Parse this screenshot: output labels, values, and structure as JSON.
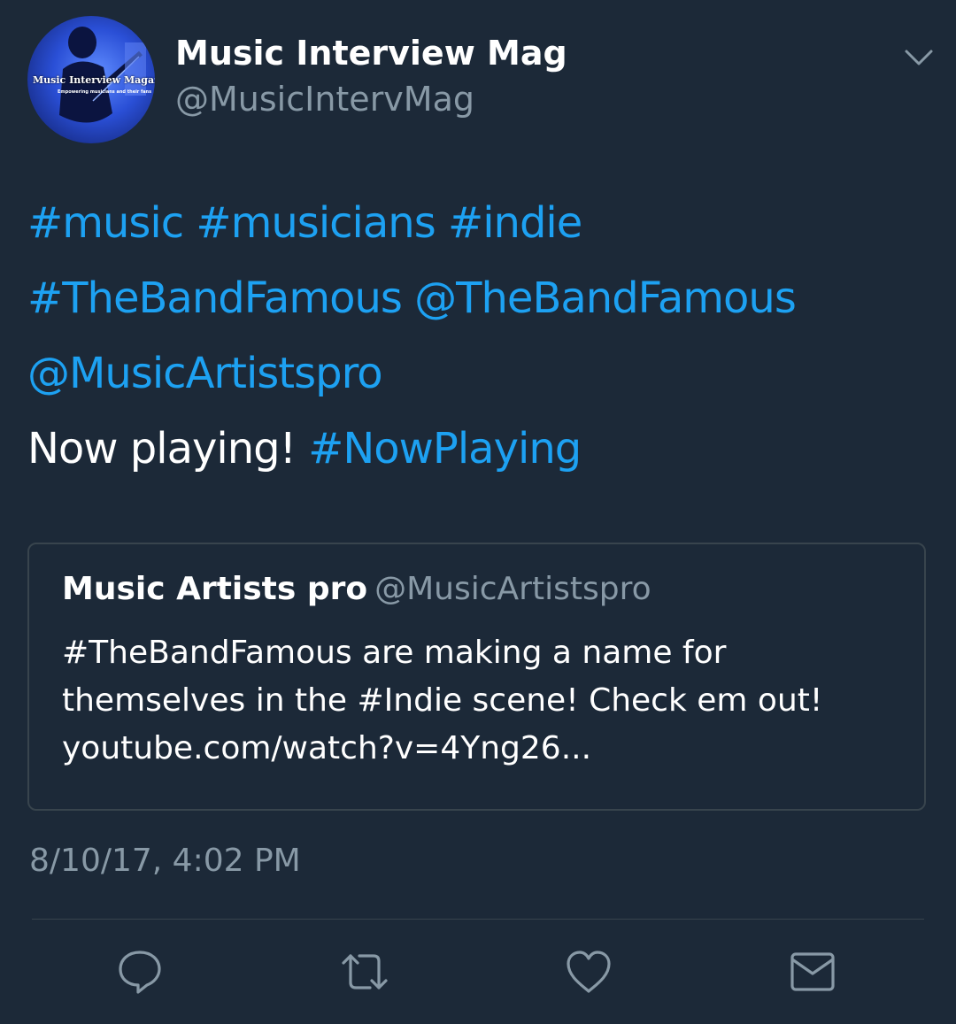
{
  "author": {
    "display_name": "Music Interview Mag",
    "handle": "@MusicIntervMag",
    "avatar_title": "Music Interview Magazine",
    "avatar_subtitle": "Empowering musicians and their fans"
  },
  "tweet": {
    "lines": [
      [
        {
          "text": "#music",
          "type": "link"
        },
        {
          "text": " ",
          "type": "text"
        },
        {
          "text": "#musicians",
          "type": "link"
        },
        {
          "text": " ",
          "type": "text"
        },
        {
          "text": "#indie",
          "type": "link"
        }
      ],
      [
        {
          "text": "#TheBandFamous",
          "type": "link"
        },
        {
          "text": " ",
          "type": "text"
        },
        {
          "text": "@TheBandFamous",
          "type": "link"
        }
      ],
      [
        {
          "text": "@MusicArtistspro",
          "type": "link"
        }
      ],
      [
        {
          "text": "Now playing! ",
          "type": "text"
        },
        {
          "text": "#NowPlaying",
          "type": "link"
        }
      ]
    ]
  },
  "quoted_tweet": {
    "name": "Music Artists pro",
    "handle": "@MusicArtistspro",
    "lines": [
      "#TheBandFamous are making a name for",
      "themselves in the #Indie scene! Check em out!",
      "youtube.com/watch?v=4Yng26..."
    ]
  },
  "timestamp": "8/10/17, 4:02 PM",
  "actions": [
    {
      "name": "reply",
      "icon": "reply-icon"
    },
    {
      "name": "retweet",
      "icon": "retweet-icon"
    },
    {
      "name": "like",
      "icon": "heart-icon"
    },
    {
      "name": "direct-message",
      "icon": "envelope-icon"
    }
  ],
  "colors": {
    "background": "#1c2938",
    "link": "#1da1f2",
    "secondary_text": "#8899a6",
    "border": "#38444d",
    "primary_text": "#ffffff"
  }
}
